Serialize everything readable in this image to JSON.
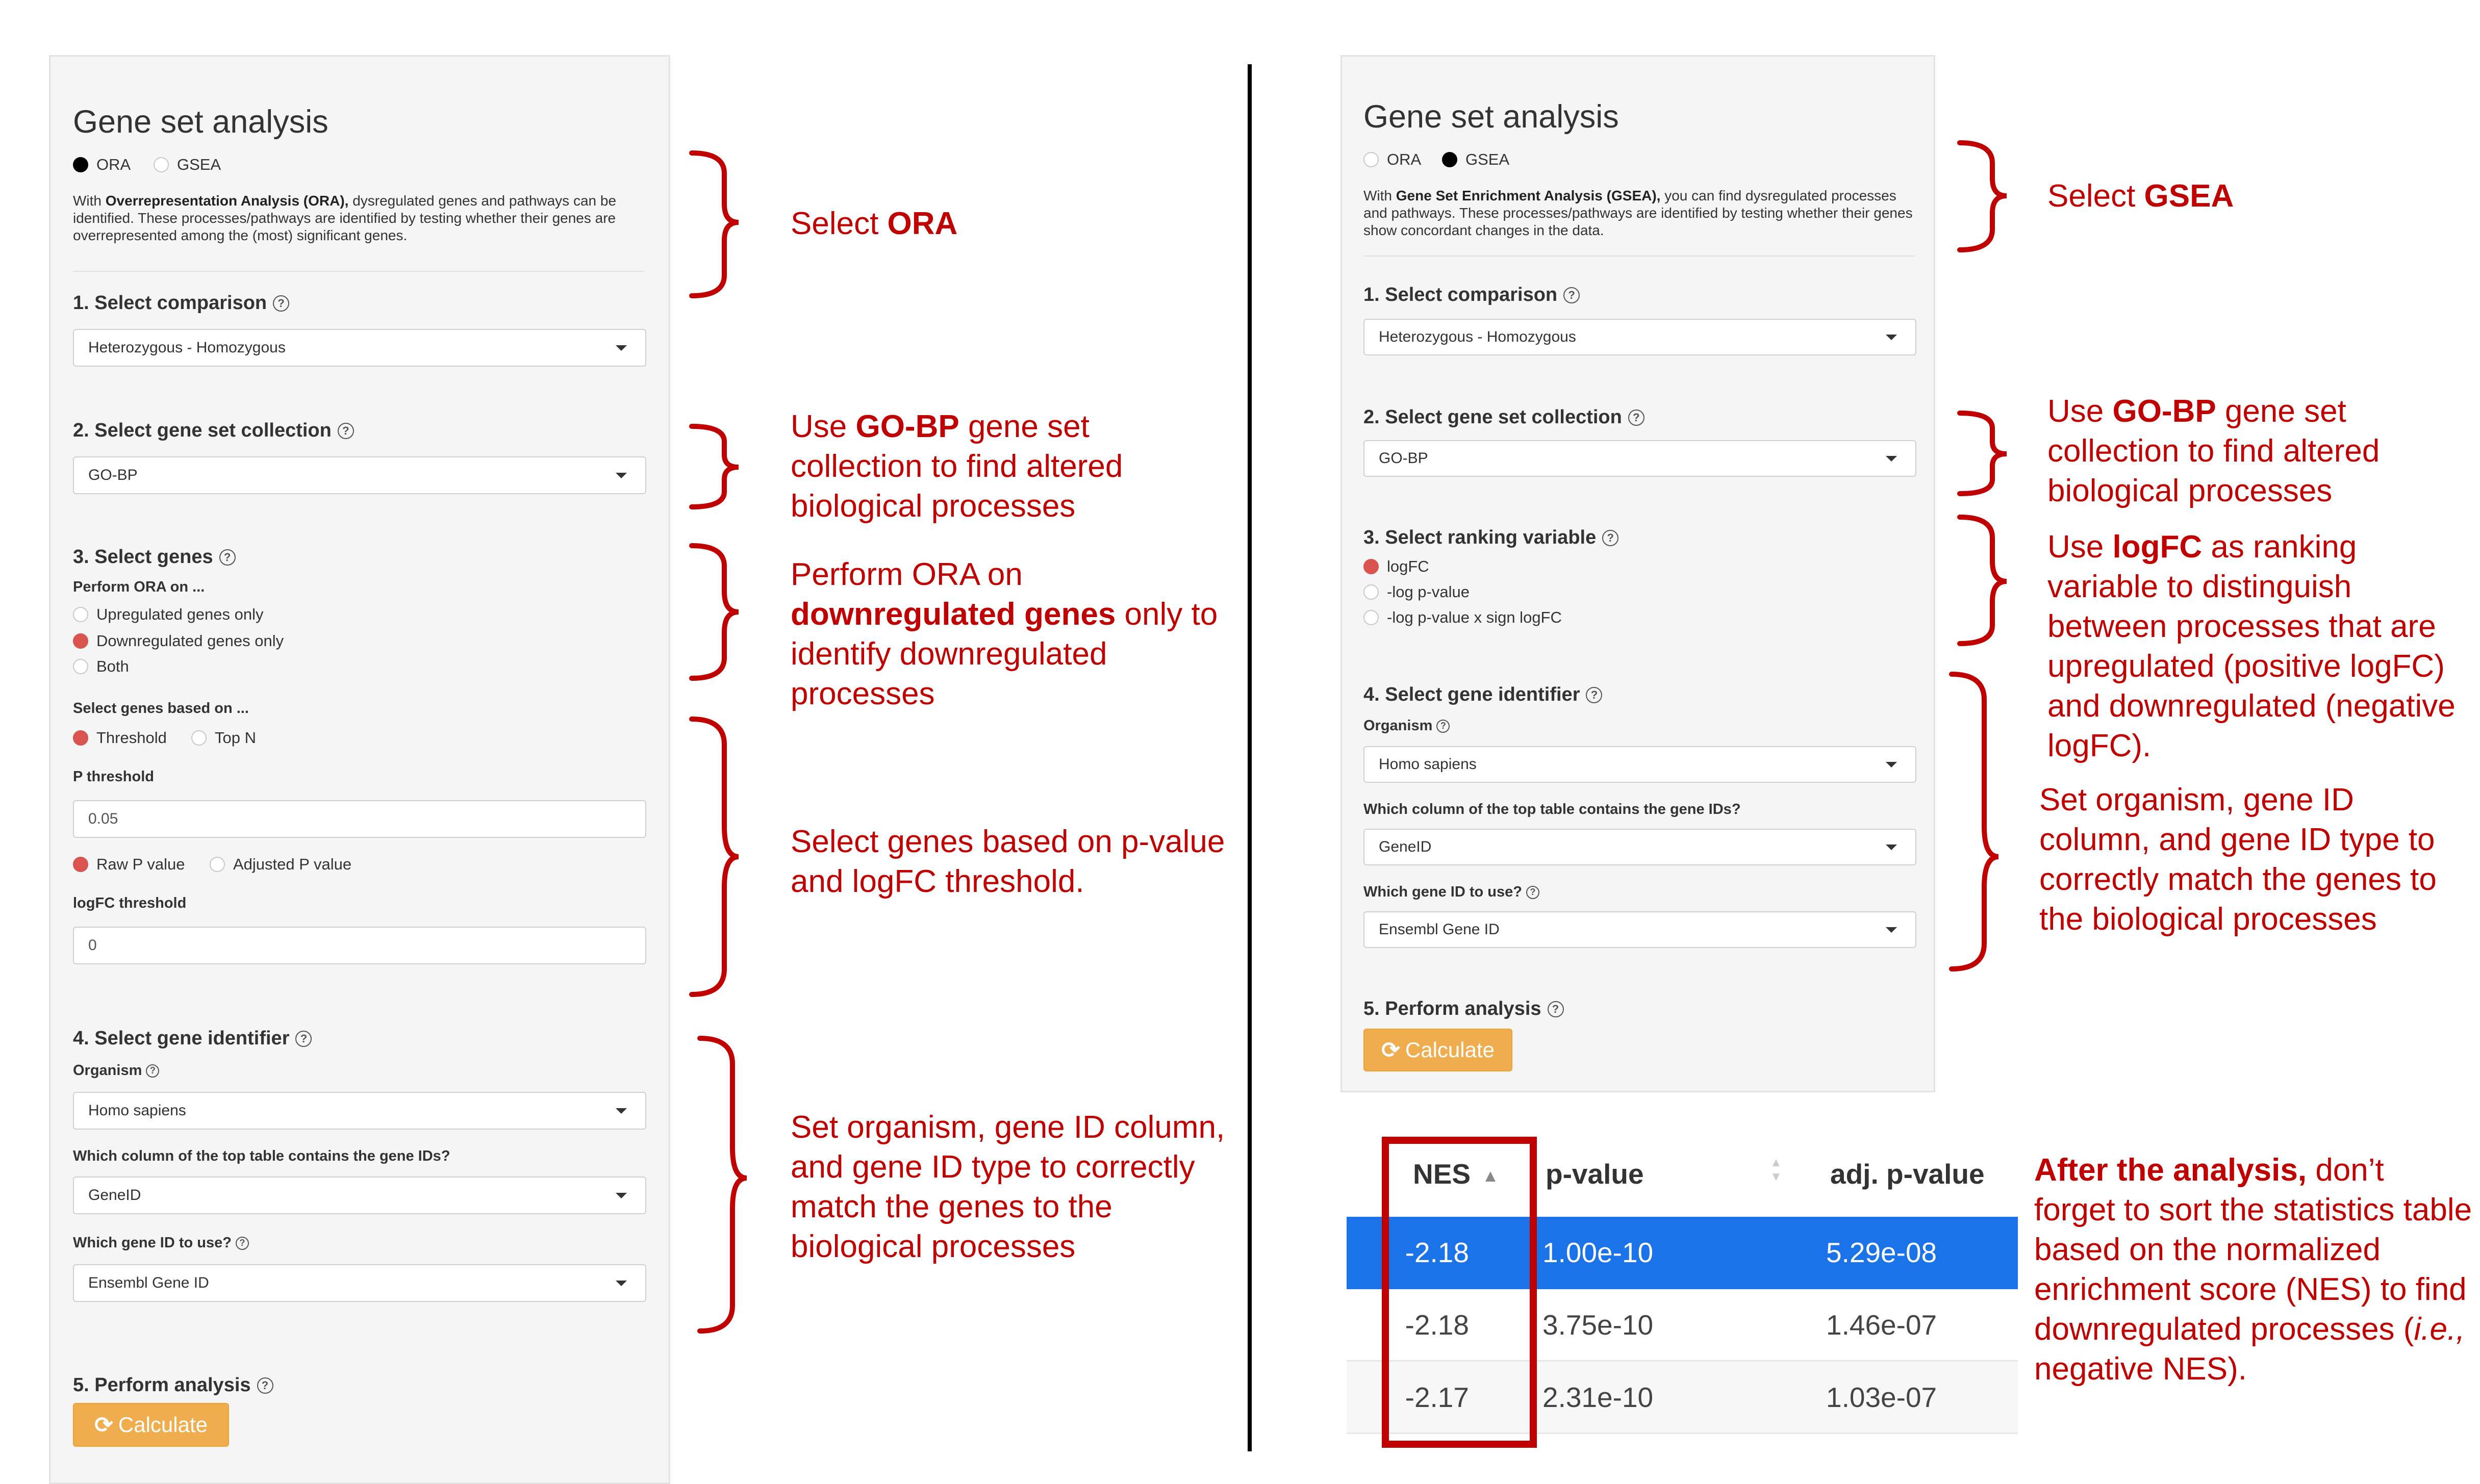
{
  "ora_panel": {
    "title": "Gene set analysis",
    "method_options": [
      "ORA",
      "GSEA"
    ],
    "selected_method": "ORA",
    "desc_prefix": "With ",
    "desc_bold": "Overrepresentation Analysis (ORA),",
    "desc_rest": " dysregulated genes and pathways can be identified. These processes/pathways are identified by testing whether their genes are overrepresented among the (most) significant genes.",
    "step1_label": "1. Select comparison",
    "comparison_value": "Heterozygous - Homozygous",
    "step2_label": "2. Select gene set collection",
    "collection_value": "GO-BP",
    "step3_label": "3. Select genes",
    "perform_on_label": "Perform ORA on ...",
    "perform_on_options": [
      "Upregulated genes only",
      "Downregulated genes only",
      "Both"
    ],
    "perform_on_selected": "Downregulated genes only",
    "based_on_label": "Select genes based on ...",
    "based_on_options": [
      "Threshold",
      "Top N"
    ],
    "based_on_selected": "Threshold",
    "p_threshold_label": "P threshold",
    "p_threshold_value": "0.05",
    "p_type_options": [
      "Raw P value",
      "Adjusted P value"
    ],
    "p_type_selected": "Raw P value",
    "logfc_label": "logFC threshold",
    "logfc_value": "0",
    "step4_label": "4. Select gene identifier",
    "organism_label": "Organism",
    "organism_value": "Homo sapiens",
    "column_label": "Which column of the top table contains the gene IDs?",
    "column_value": "GeneID",
    "geneid_label": "Which gene ID to use?",
    "geneid_value": "Ensembl Gene ID",
    "step5_label": "5. Perform analysis",
    "calculate_label": "Calculate"
  },
  "gsea_panel": {
    "title": "Gene set analysis",
    "method_options": [
      "ORA",
      "GSEA"
    ],
    "selected_method": "GSEA",
    "desc_prefix": "With ",
    "desc_bold": "Gene Set Enrichment Analysis (GSEA),",
    "desc_rest": " you can find dysregulated processes and pathways. These processes/pathways are identified by testing whether their genes show concordant changes in the data.",
    "step1_label": "1. Select comparison",
    "comparison_value": "Heterozygous - Homozygous",
    "step2_label": "2. Select gene set collection",
    "collection_value": "GO-BP",
    "step3_label": "3. Select ranking variable",
    "ranking_options": [
      "logFC",
      "-log p-value",
      "-log p-value x sign logFC"
    ],
    "ranking_selected": "logFC",
    "step4_label": "4. Select gene identifier",
    "organism_label": "Organism",
    "organism_value": "Homo sapiens",
    "column_label": "Which column of the top table contains the gene IDs?",
    "column_value": "GeneID",
    "geneid_label": "Which gene ID to use?",
    "geneid_value": "Ensembl Gene ID",
    "step5_label": "5. Perform analysis",
    "calculate_label": "Calculate"
  },
  "results_table": {
    "columns": [
      "NES",
      "p-value",
      "adj. p-value"
    ],
    "rows": [
      [
        "-2.18",
        "1.00e-10",
        "5.29e-08"
      ],
      [
        "-2.18",
        "3.75e-10",
        "1.46e-07"
      ],
      [
        "-2.17",
        "2.31e-10",
        "1.03e-07"
      ]
    ],
    "selected_row_index": 0,
    "selected_row_color": "#1a73e8",
    "sorted_column": "NES"
  },
  "annotations": {
    "ora_select": {
      "pre": "Select ",
      "bold": "ORA"
    },
    "ora_gobp": {
      "pre": "Use ",
      "bold": "GO-BP",
      "post": " gene set collection to find altered biological processes"
    },
    "ora_down": {
      "pre": "Perform ORA on ",
      "bold": "downregulated genes",
      "post": " only to identify downregulated processes"
    },
    "ora_threshold": {
      "text": "Select genes based on p-value and logFC threshold."
    },
    "ora_organism": {
      "text": "Set organism, gene ID column, and gene ID type to correctly match the genes to the biological processes"
    },
    "gsea_select": {
      "pre": "Select ",
      "bold": "GSEA"
    },
    "gsea_gobp": {
      "pre": "Use ",
      "bold": "GO-BP",
      "post": " gene set collection to find altered biological processes"
    },
    "gsea_logfc": {
      "pre": "Use ",
      "bold": "logFC",
      "post": " as ranking variable to distinguish between processes that are upregulated (positive logFC) and downregulated (negative logFC)."
    },
    "gsea_organism": {
      "text": "Set organism, gene ID column, and gene ID type to correctly match the genes to the biological processes"
    },
    "after": {
      "bold": "After the analysis,",
      "post1": " don’t forget to sort the statistics table based on the normalized enrichment score (NES) to find downregulated processes (",
      "italic": "i.e.,",
      "post2": " negative NES)."
    }
  },
  "colors": {
    "annotation_red": "#c00000",
    "radio_selected": "#d9534f",
    "calculate_button": "#f0ad4e"
  }
}
